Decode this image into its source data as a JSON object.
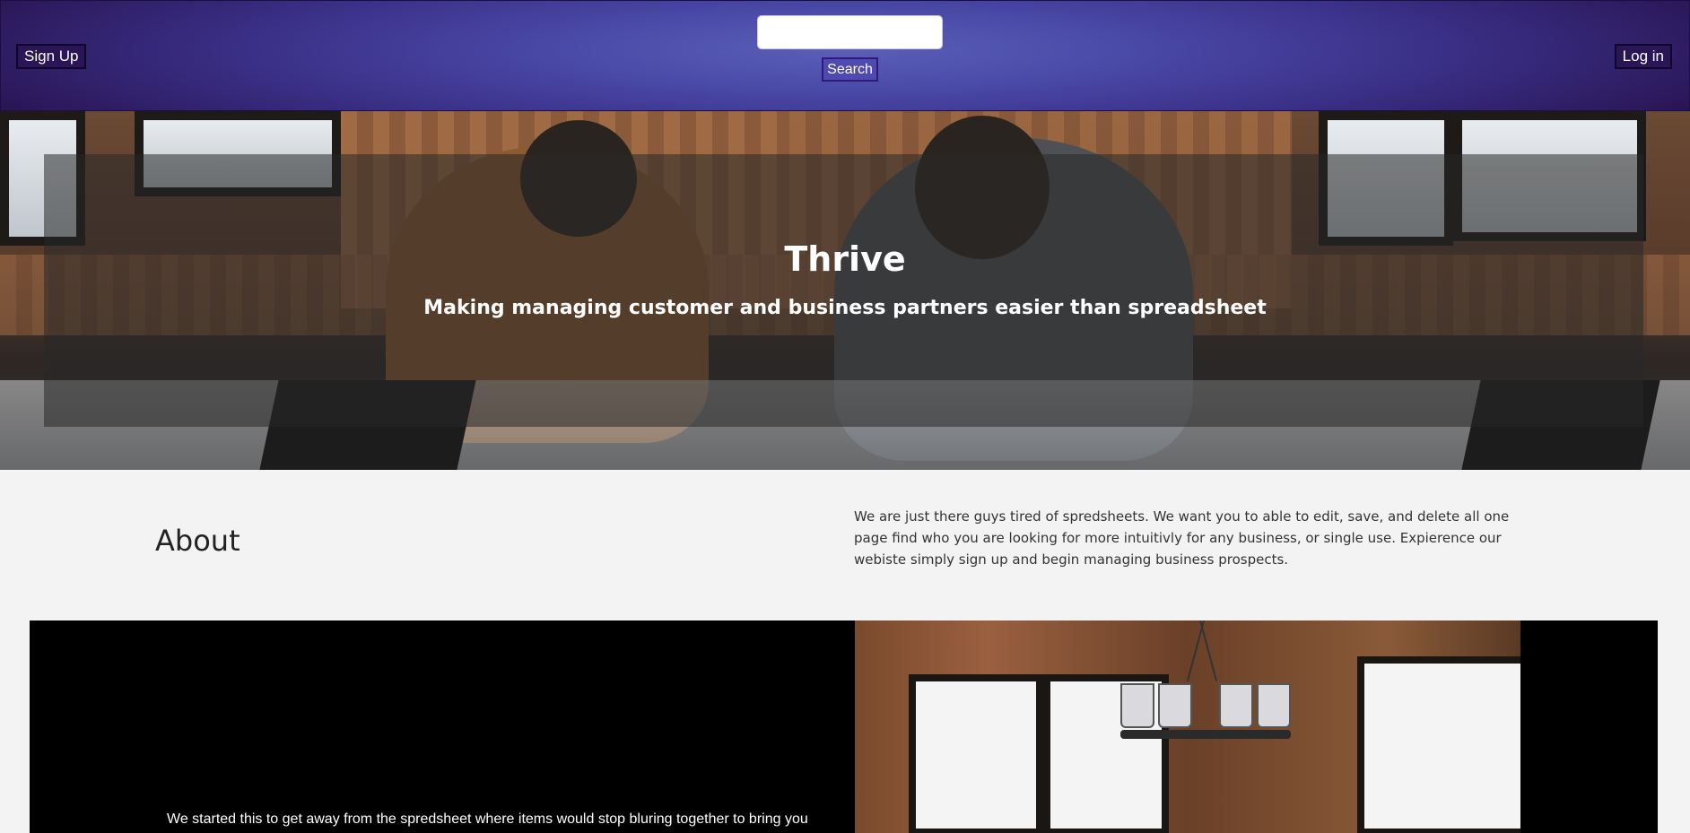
{
  "header": {
    "signup_label": "Sign Up",
    "login_label": "Log in",
    "search_value": "",
    "search_button_label": "Search"
  },
  "hero": {
    "title": "Thrive",
    "subtitle": "Making managing customer and business partners easier than spreadsheet"
  },
  "about": {
    "heading": "About",
    "body": "We are just there guys tired of spredsheets. We want you to able to edit, save, and delete all one page find who you are looking for more intuitivly for any business, or single use. Expierence our webiste simply sign up and begin managing business prospects."
  },
  "story": {
    "text": "We started this to get away from the spredsheet where items would stop bluring together to bring you"
  },
  "colors": {
    "header_center": "#5a5fb8",
    "header_edge": "#2a1656",
    "page_bg": "#f3f3f3",
    "story_bg": "#000000"
  }
}
